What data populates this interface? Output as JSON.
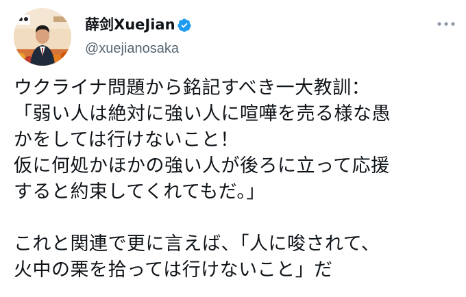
{
  "author": {
    "display_name": "薛剑XueJian",
    "handle": "@xuejianosaka",
    "verified": true,
    "verified_color": "#1d9bf0"
  },
  "icons": {
    "verified": "verified-badge-icon",
    "more": "more-options-icon"
  },
  "tweet": {
    "lines": [
      "ウクライナ問題から銘記すべき一大教訓：",
      "「弱い人は絶対に強い人に喧嘩を売る様な愚",
      "かをしては行けないこと！",
      "仮に何処かほかの強い人が後ろに立って応援",
      "すると約束してくれてもだ。」",
      "これと関連で更に言えば、「人に唆されて、",
      "火中の栗を拾っては行けないこと」だ"
    ]
  }
}
